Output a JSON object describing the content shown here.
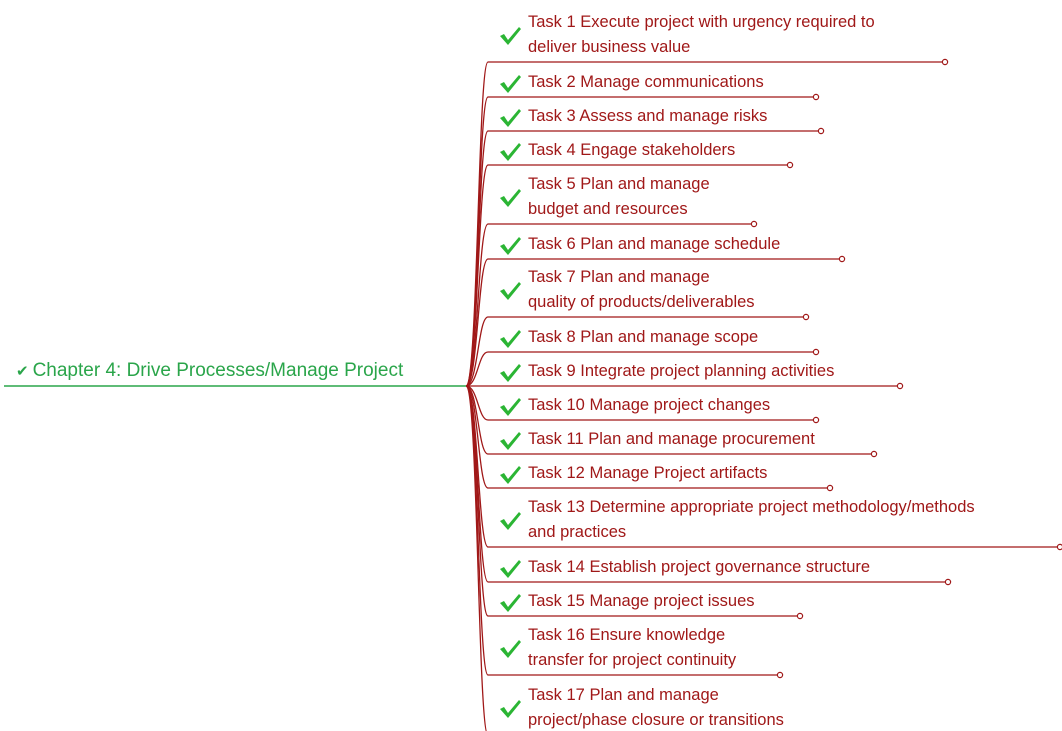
{
  "map": {
    "root": {
      "label": "Chapter 4: Drive Processes/Manage Project",
      "icon": "checkmark-icon",
      "color": "#2aa54a"
    },
    "branch_color": "#a01818",
    "check_color": "#2bb534",
    "tasks": [
      {
        "label": "Task 1 Execute project with urgency required to\ndeliver business value"
      },
      {
        "label": "Task 2 Manage communications"
      },
      {
        "label": "Task 3 Assess and manage risks"
      },
      {
        "label": "Task 4 Engage stakeholders"
      },
      {
        "label": "Task 5 Plan and manage\nbudget and resources"
      },
      {
        "label": "Task 6 Plan and manage schedule"
      },
      {
        "label": "Task 7 Plan and manage\nquality of products/deliverables"
      },
      {
        "label": "Task 8 Plan and manage scope"
      },
      {
        "label": "Task 9 Integrate project planning activities"
      },
      {
        "label": "Task 10 Manage project changes"
      },
      {
        "label": "Task 11 Plan and manage procurement"
      },
      {
        "label": "Task 12 Manage Project artifacts"
      },
      {
        "label": "Task 13 Determine appropriate project methodology/methods\nand practices"
      },
      {
        "label": "Task 14 Establish project governance structure"
      },
      {
        "label": "Task 15 Manage project issues"
      },
      {
        "label": "Task 16 Ensure knowledge\ntransfer for project continuity"
      },
      {
        "label": "Task 17 Plan and manage\nproject/phase closure or transitions"
      }
    ]
  }
}
